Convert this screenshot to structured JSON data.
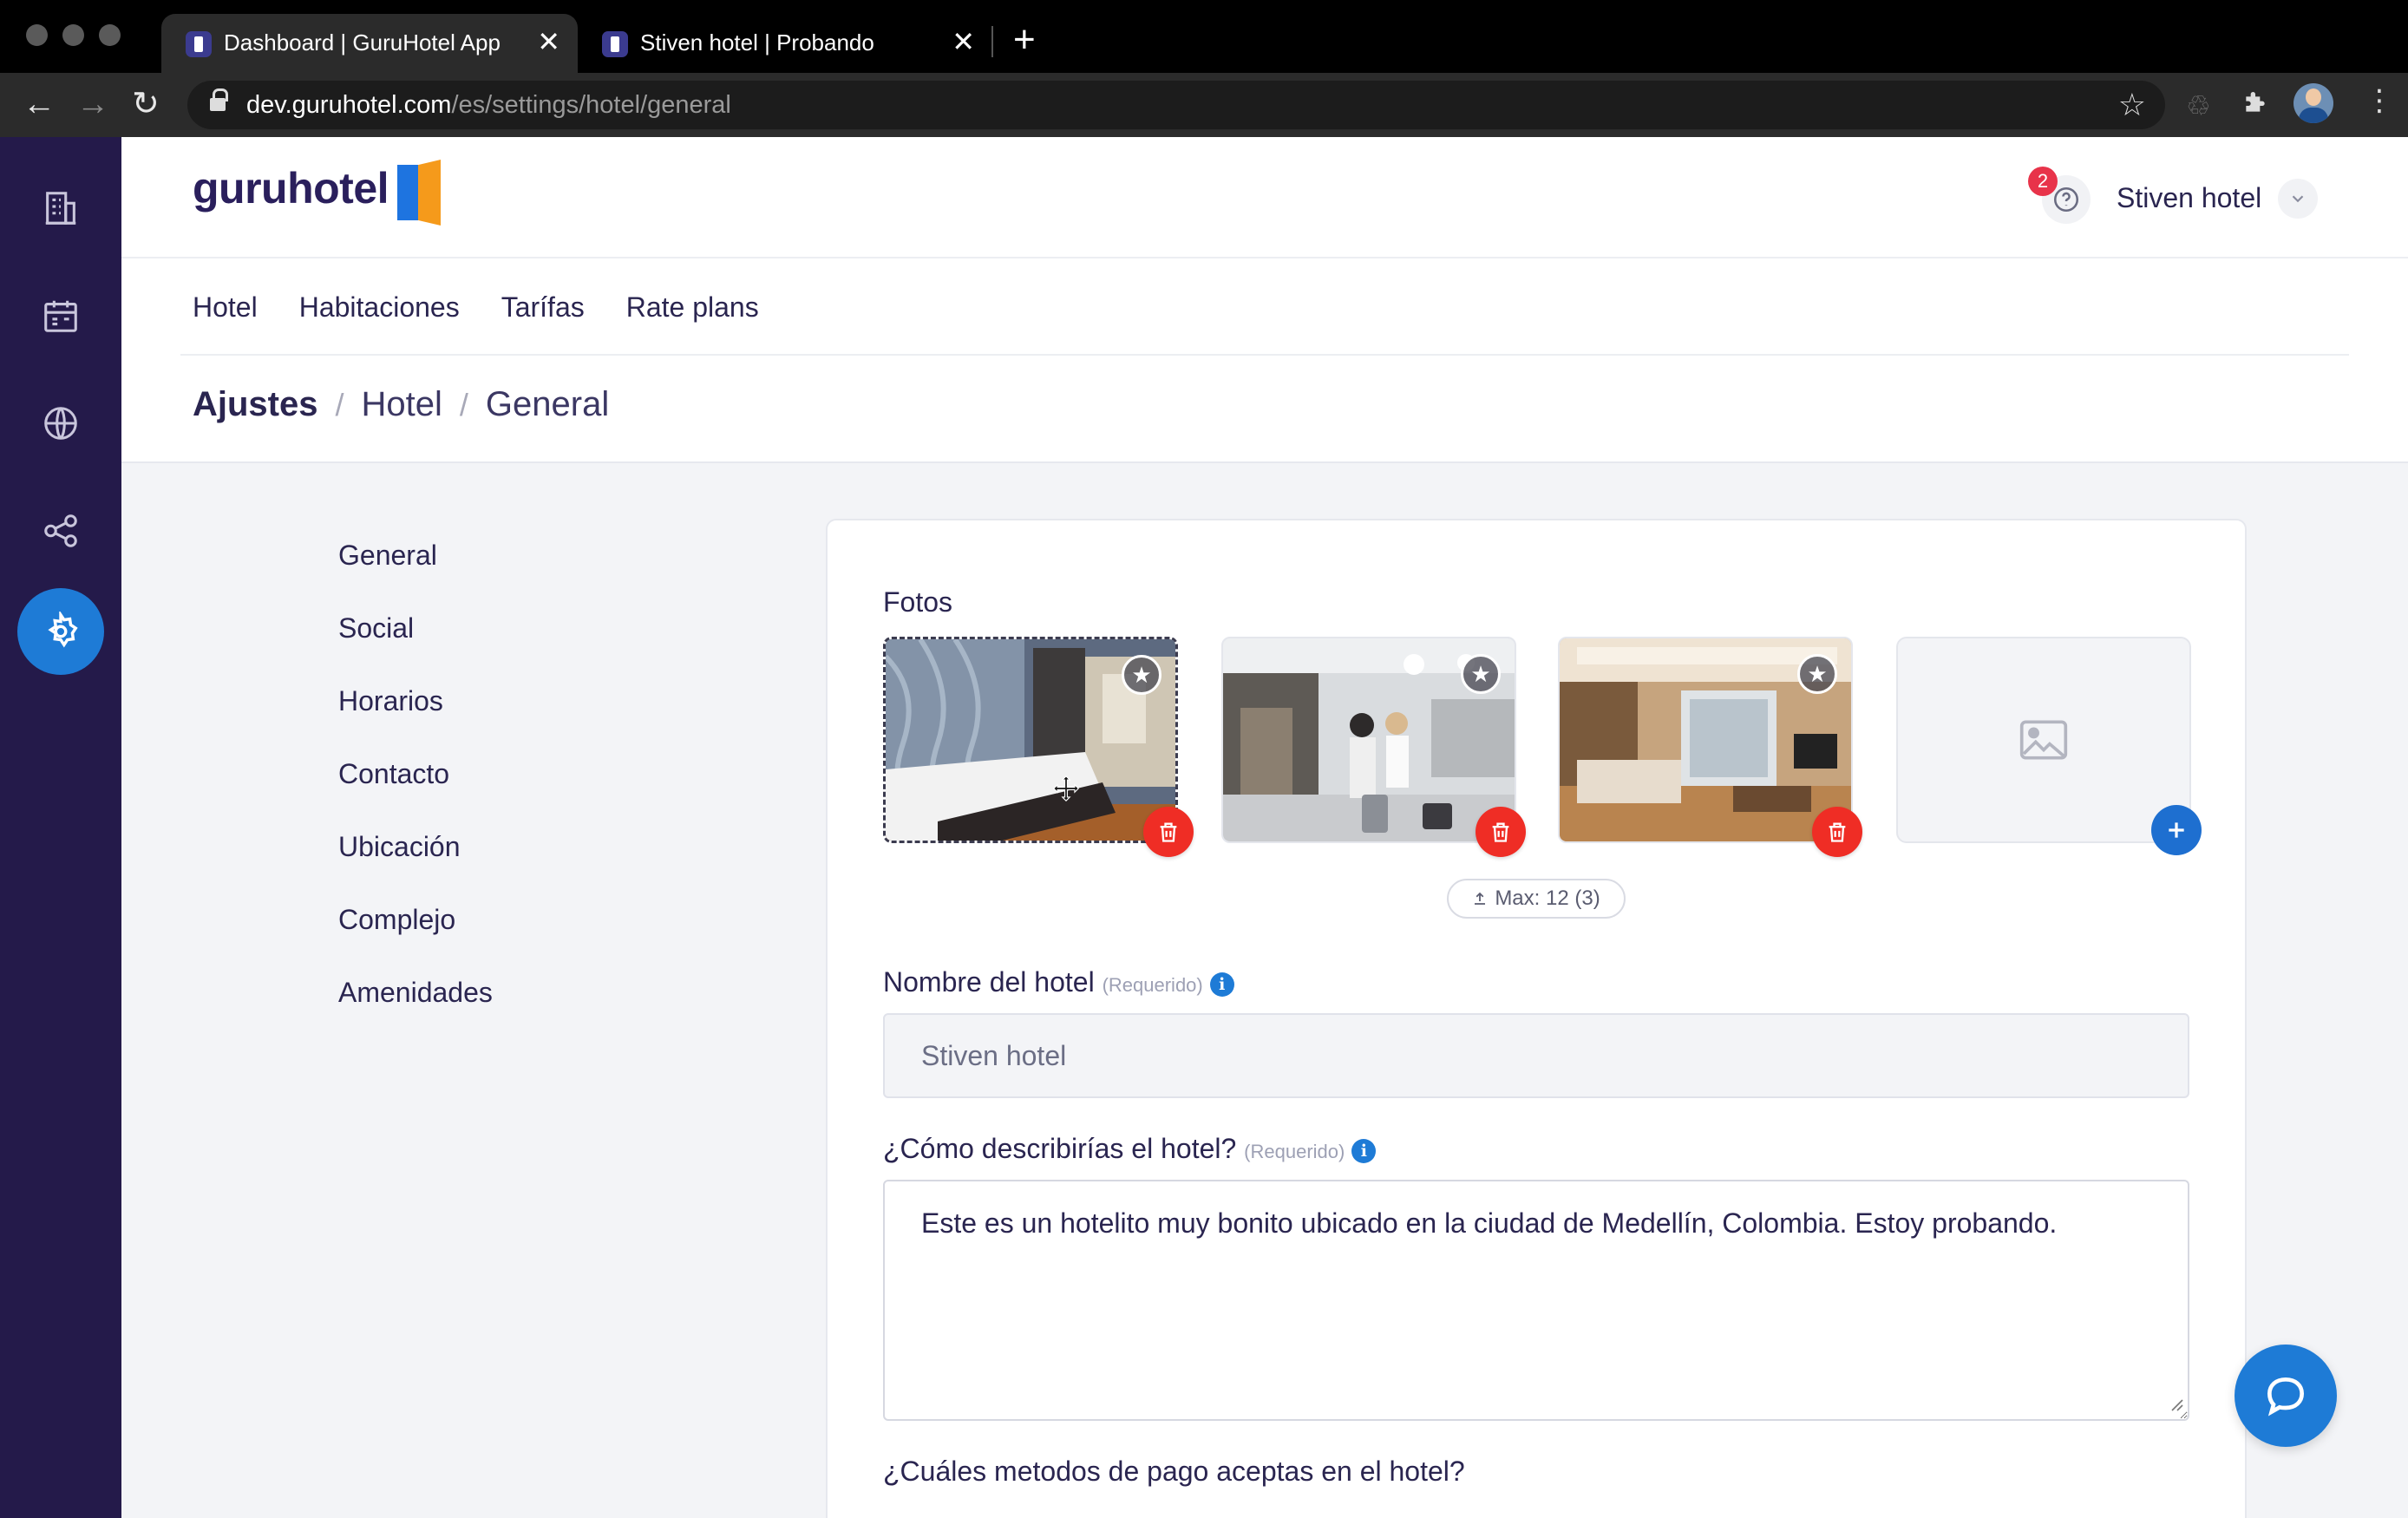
{
  "browser": {
    "tabs": [
      {
        "title": "Dashboard | GuruHotel App",
        "close": "✕",
        "active": true
      },
      {
        "title": "Stiven hotel | Probando",
        "close": "✕",
        "active": false
      }
    ],
    "new_tab": "+",
    "url_host": "dev.guruhotel.com",
    "url_path": "/es/settings/hotel/general"
  },
  "app": {
    "logo_text": "guruhotel",
    "notification_count": "2",
    "user_name": "Stiven hotel",
    "subnav": [
      "Hotel",
      "Habitaciones",
      "Tarífas",
      "Rate plans"
    ],
    "breadcrumb": [
      "Ajustes",
      "Hotel",
      "General"
    ],
    "breadcrumb_sep": "/",
    "settings_menu": [
      "General",
      "Social",
      "Horarios",
      "Contacto",
      "Ubicación",
      "Complejo",
      "Amenidades"
    ],
    "sidebar_icons": [
      "building-icon",
      "calendar-icon",
      "globe-icon",
      "share-icon",
      "gear-icon"
    ]
  },
  "form": {
    "photos_label": "Fotos",
    "photos_max": "Max: 12 (3)",
    "hotel_name_label": "Nombre del hotel",
    "required_hint": "(Requerido)",
    "hotel_name_value": "Stiven hotel",
    "description_label": "¿Cómo describirías el hotel?",
    "description_value": "Este es un hotelito muy bonito ubicado en la ciudad de Medellín, Colombia. Estoy probando.",
    "payment_label": "¿Cuáles metodos de pago aceptas en el hotel?",
    "info_glyph": "i"
  },
  "colors": {
    "sidebar": "#241a4a",
    "accent": "#1e7bd6",
    "delete": "#ef2d25",
    "badge": "#e8334a",
    "logo_blue": "#1e74e0",
    "logo_orange": "#f59a1b"
  }
}
